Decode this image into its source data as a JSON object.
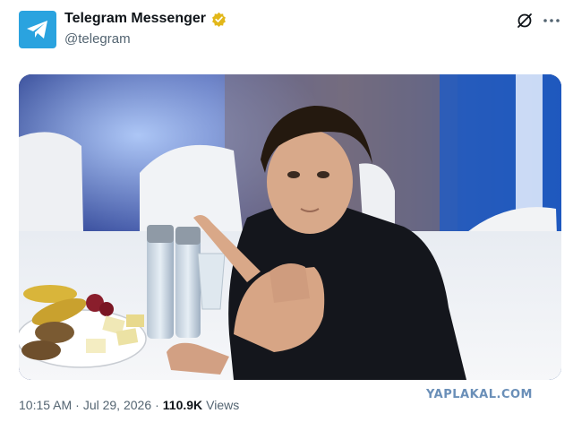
{
  "author": {
    "display_name": "Telegram Messenger",
    "handle": "@telegram",
    "verified_badge_color": "#e2b719",
    "avatar_color": "#2aa3df",
    "avatar_icon": "telegram-paper-plane-icon"
  },
  "actions": {
    "grok_icon": "grok-icon",
    "more_icon": "more-options-icon"
  },
  "media": {
    "type": "photo"
  },
  "meta": {
    "time": "10:15 AM",
    "separator": "·",
    "date": "Jul 29, 2026",
    "views_count": "110.9K",
    "views_label": "Views"
  },
  "watermark": "YAPLAKAL.COM"
}
